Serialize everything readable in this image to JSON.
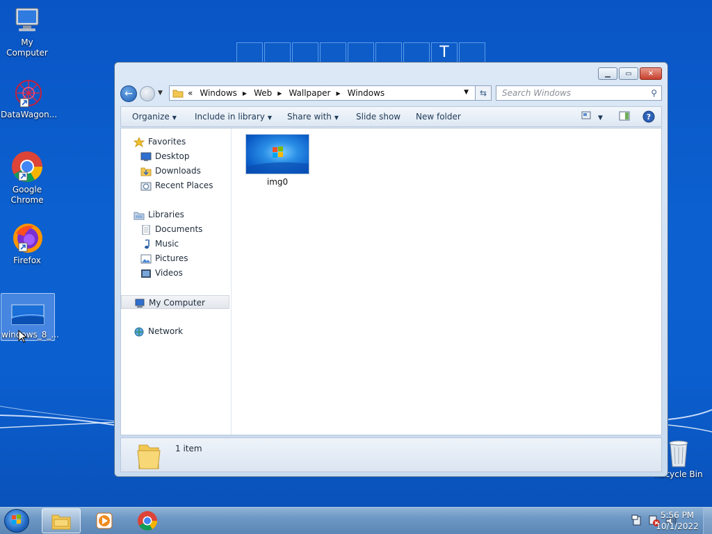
{
  "desktop": {
    "tiles_letter": "T",
    "icons": [
      {
        "label": "My Computer"
      },
      {
        "label": "DataWagon..."
      },
      {
        "label": "Google Chrome"
      },
      {
        "label": "Firefox"
      },
      {
        "label": "windows_8_..."
      },
      {
        "label": "Recycle Bin"
      }
    ]
  },
  "explorer": {
    "address": {
      "overflow": "«",
      "segments": [
        "Windows",
        "Web",
        "Wallpaper",
        "Windows"
      ]
    },
    "search_placeholder": "Search Windows",
    "toolbar": {
      "organize": "Organize",
      "include_in_library": "Include in library",
      "share_with": "Share with",
      "slide_show": "Slide show",
      "new_folder": "New folder"
    },
    "nav": {
      "favorites": "Favorites",
      "desktop": "Desktop",
      "downloads": "Downloads",
      "recent_places": "Recent Places",
      "libraries": "Libraries",
      "documents": "Documents",
      "music": "Music",
      "pictures": "Pictures",
      "videos": "Videos",
      "my_computer": "My Computer",
      "network": "Network"
    },
    "files": [
      {
        "name": "img0"
      }
    ],
    "status": {
      "count": "1 item"
    }
  },
  "taskbar": {
    "time": "5:56 PM",
    "date": "10/1/2022"
  },
  "colors": {
    "desktop_bg": "#0c60cf",
    "close_button": "#c7402c",
    "taskbar": "#6d97c4"
  }
}
